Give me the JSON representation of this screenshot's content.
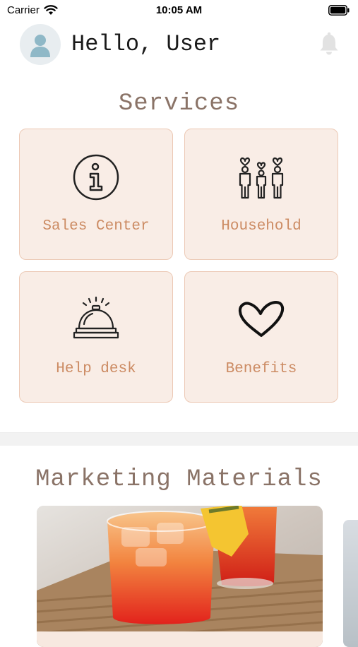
{
  "status": {
    "carrier": "Carrier",
    "time": "10:05 AM"
  },
  "header": {
    "greeting": "Hello, User"
  },
  "services": {
    "title": "Services",
    "items": [
      {
        "label": "Sales Center",
        "icon": "info-icon"
      },
      {
        "label": "Household",
        "icon": "family-icon"
      },
      {
        "label": "Help desk",
        "icon": "service-bell-icon"
      },
      {
        "label": "Benefits",
        "icon": "heart-icon"
      }
    ]
  },
  "marketing": {
    "title": "Marketing Materials"
  },
  "colors": {
    "accent": "#cc8b63",
    "tile_bg": "#f9ede6",
    "tile_border": "#ecc9b5",
    "heading": "#8a7367"
  }
}
